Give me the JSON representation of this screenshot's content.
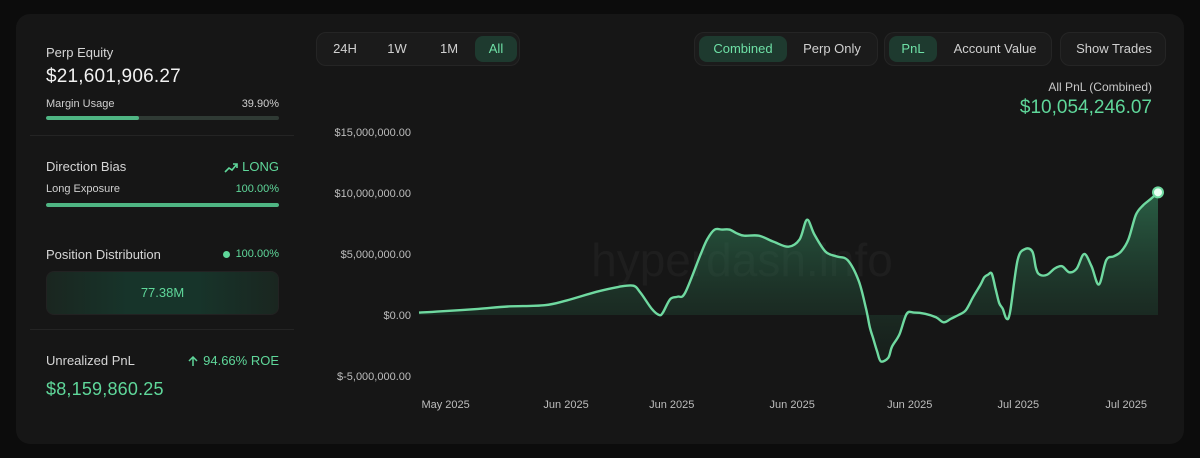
{
  "left": {
    "perp_equity_label": "Perp Equity",
    "perp_equity_value": "$21,601,906.27",
    "margin_usage_label": "Margin Usage",
    "margin_usage_value": "39.90%",
    "margin_usage_fraction": 0.399,
    "direction_bias_label": "Direction Bias",
    "direction_bias_value": "LONG",
    "long_exposure_label": "Long Exposure",
    "long_exposure_value": "100.00%",
    "long_exposure_fraction": 1.0,
    "position_distribution_label": "Position Distribution",
    "position_distribution_value": "100.00%",
    "position_distribution_box": "77.38M",
    "unrealized_pnl_label": "Unrealized PnL",
    "roe_value": "94.66% ROE",
    "unrealized_pnl_value": "$8,159,860.25"
  },
  "timeframes": [
    "24H",
    "1W",
    "1M",
    "All"
  ],
  "timeframe_active": "All",
  "modes": [
    "Combined",
    "Perp Only"
  ],
  "mode_active": "Combined",
  "metrics": [
    "PnL",
    "Account Value"
  ],
  "metric_active": "PnL",
  "show_trades_label": "Show Trades",
  "summary": {
    "label": "All PnL (Combined)",
    "value": "$10,054,246.07"
  },
  "watermark": "hyperdash.info",
  "colors": {
    "accent": "#5fd79a",
    "line": "#6fd9a0",
    "background": "#161616"
  },
  "chart_data": {
    "type": "area",
    "y_ticks": [
      15000000,
      10000000,
      5000000,
      0,
      -5000000
    ],
    "y_tick_labels": [
      "$15,000,000.00",
      "$10,000,000.00",
      "$5,000,000.00",
      "$0.00",
      "$-5,000,000.00"
    ],
    "ylim": [
      -5000000,
      15000000
    ],
    "x_tick_labels": [
      "May 2025",
      "Jun 2025",
      "Jun 2025",
      "Jun 2025",
      "Jun 2025",
      "Jul 2025",
      "Jul 2025"
    ],
    "x_tick_positions": [
      0.036,
      0.199,
      0.342,
      0.505,
      0.664,
      0.811,
      0.957
    ],
    "grid": false,
    "series": [
      {
        "x": [
          0,
          0.03,
          0.08,
          0.12,
          0.17,
          0.2,
          0.24,
          0.27,
          0.29,
          0.3,
          0.315,
          0.325,
          0.33,
          0.34,
          0.35,
          0.36,
          0.38,
          0.39,
          0.4,
          0.41,
          0.42,
          0.43,
          0.44,
          0.46,
          0.48,
          0.5,
          0.515,
          0.525,
          0.535,
          0.55,
          0.565,
          0.58,
          0.595,
          0.605,
          0.61,
          0.615,
          0.62,
          0.625,
          0.635,
          0.64,
          0.65,
          0.66,
          0.67,
          0.685,
          0.7,
          0.71,
          0.72,
          0.73,
          0.74,
          0.75,
          0.76,
          0.765,
          0.77,
          0.775,
          0.78,
          0.785,
          0.79,
          0.795,
          0.8,
          0.81,
          0.82,
          0.83,
          0.835,
          0.84,
          0.85,
          0.86,
          0.87,
          0.88,
          0.89,
          0.9,
          0.91,
          0.92,
          0.93,
          0.94,
          0.95,
          0.96,
          0.97,
          0.98,
          0.99,
          1.0
        ],
        "values": [
          200000,
          300000,
          500000,
          700000,
          800000,
          1200000,
          1900000,
          2300000,
          2400000,
          1800000,
          500000,
          0,
          200000,
          1300000,
          1500000,
          1800000,
          4800000,
          6200000,
          7000000,
          7000000,
          7000000,
          6700000,
          6500000,
          6500000,
          6000000,
          5600000,
          6200000,
          7800000,
          6600000,
          5200000,
          4800000,
          4500000,
          2800000,
          500000,
          -1000000,
          -2000000,
          -3000000,
          -3800000,
          -3500000,
          -2600000,
          -1600000,
          100000,
          200000,
          100000,
          -200000,
          -600000,
          -300000,
          0,
          400000,
          1500000,
          2500000,
          3100000,
          3300000,
          3400000,
          2200000,
          1000000,
          500000,
          -300000,
          300000,
          4500000,
          5400000,
          5200000,
          3800000,
          3300000,
          3300000,
          3800000,
          4000000,
          3500000,
          3800000,
          5000000,
          4000000,
          2500000,
          4500000,
          4800000,
          5200000,
          6200000,
          8200000,
          9000000,
          9500000,
          10054246
        ]
      }
    ]
  }
}
